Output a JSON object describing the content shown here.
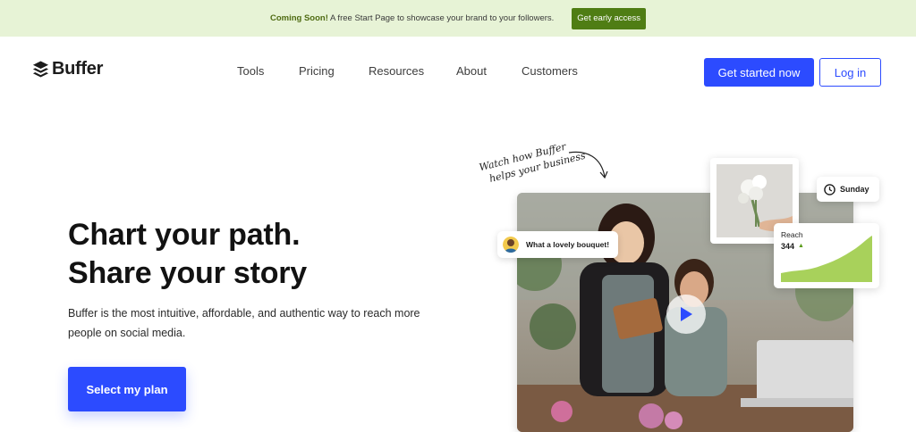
{
  "announcement": {
    "highlight": "Coming Soon!",
    "text": "A free Start Page to showcase your brand to your followers.",
    "button_label": "Get early access"
  },
  "brand": {
    "name": "Buffer",
    "icon": "stack-icon"
  },
  "nav": {
    "items": [
      {
        "label": "Tools"
      },
      {
        "label": "Pricing"
      },
      {
        "label": "Resources"
      },
      {
        "label": "About"
      },
      {
        "label": "Customers"
      }
    ],
    "get_started_label": "Get started now",
    "login_label": "Log in"
  },
  "hero": {
    "title_line1": "Chart your path.",
    "title_line2": "Share your story",
    "subtitle": "Buffer is the most intuitive, affordable, and authentic way to reach more people on social media.",
    "cta_label": "Select my plan"
  },
  "media": {
    "handwritten_line1": "Watch how Buffer",
    "handwritten_line2": "helps your business",
    "comment_text": "What a lovely bouquet!",
    "day_label": "Sunday",
    "reach_label": "Reach",
    "reach_value": "344"
  },
  "colors": {
    "primary": "#2c4bff",
    "announce_bg": "#e7f3d6",
    "announce_button": "#4f7d14",
    "chart_green": "#a8d15b"
  }
}
